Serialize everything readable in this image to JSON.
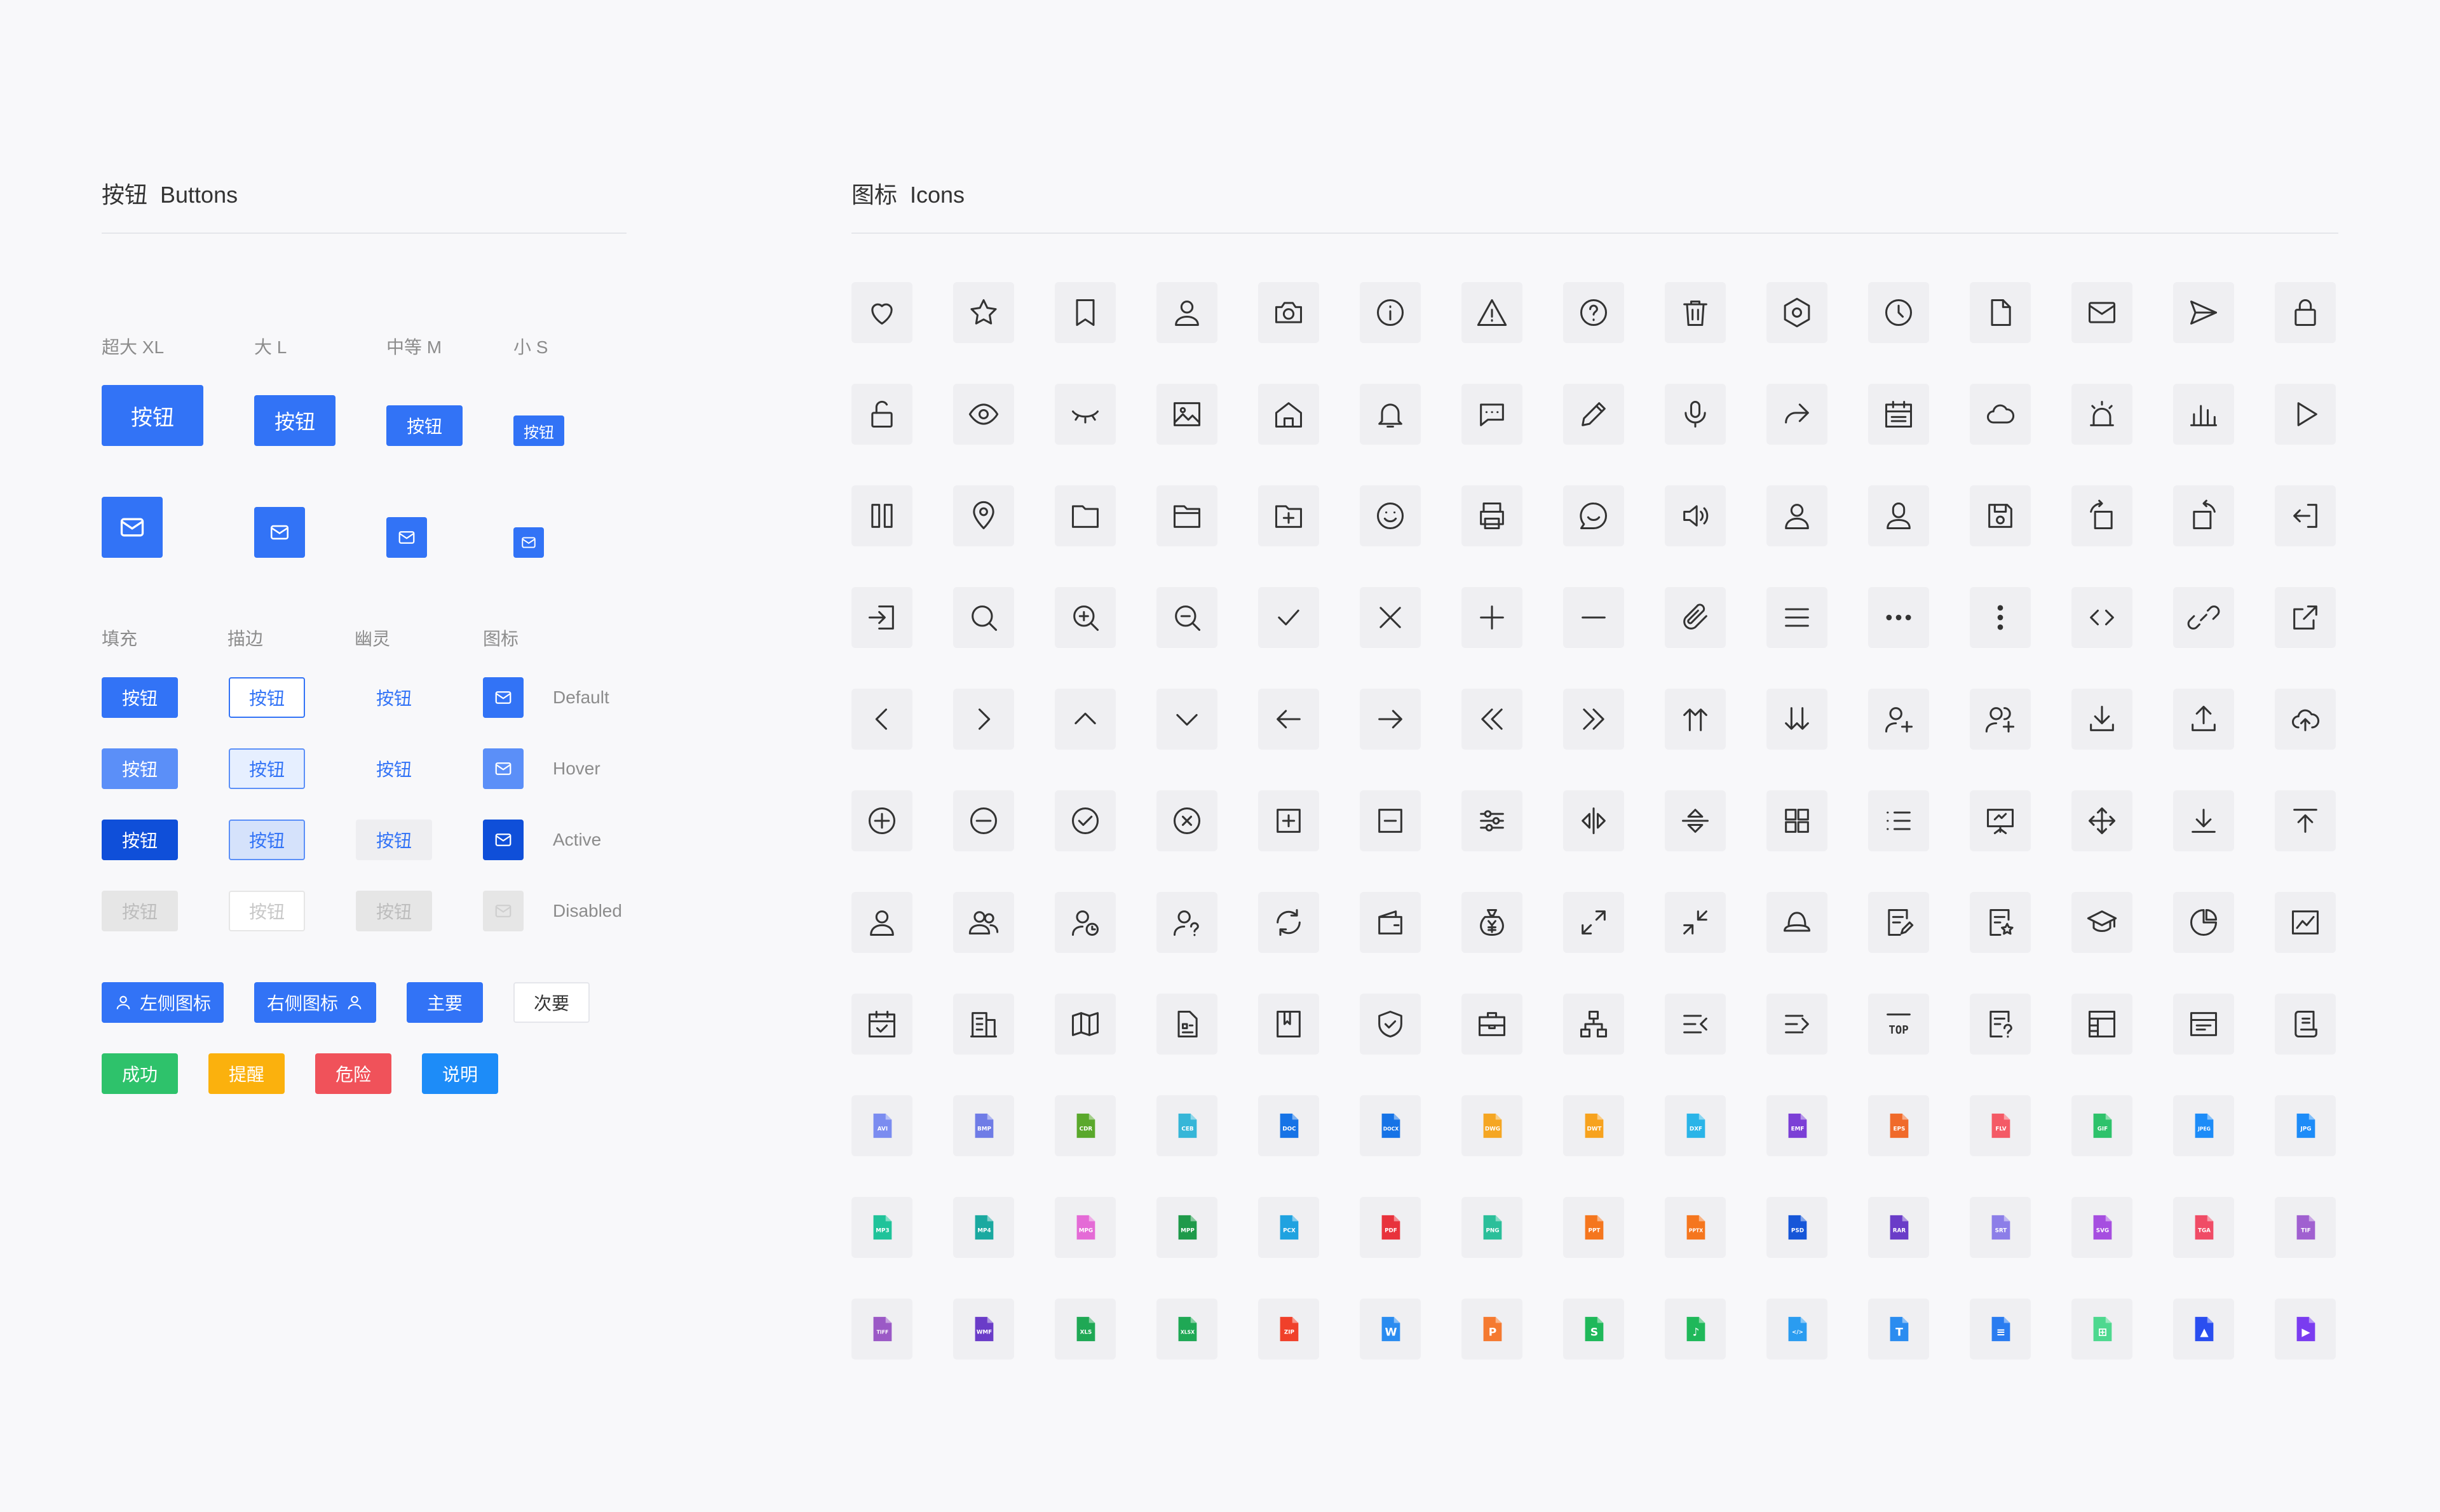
{
  "buttons_section": {
    "title": "按钮  Buttons",
    "sizes": [
      "超大 XL",
      "大 L",
      "中等 M",
      "小 S"
    ],
    "button_label": "按钮",
    "styles": [
      "填充",
      "描边",
      "幽灵",
      "图标"
    ],
    "states": [
      "Default",
      "Hover",
      "Active",
      "Disabled"
    ],
    "extra": {
      "left_icon": "左侧图标",
      "right_icon": "右侧图标",
      "primary": "主要",
      "secondary": "次要",
      "success": "成功",
      "warning": "提醒",
      "danger": "危险",
      "info": "说明"
    },
    "colors": {
      "primary": "#3273f6",
      "hover": "#5b8ff8",
      "active": "#0f4fd9",
      "disabled_bg": "#e6e6e6",
      "success": "#2ec26b",
      "warning": "#fbb10d",
      "danger": "#f0525a",
      "info": "#1d8cf8"
    }
  },
  "icons_section": {
    "title": "图标  Icons",
    "outline_icons": [
      "heart-icon",
      "star-icon",
      "bookmark-icon",
      "user-icon",
      "camera-icon",
      "info-icon",
      "warning-icon",
      "help-icon",
      "trash-icon",
      "settings-hex-icon",
      "clock-icon",
      "file-icon",
      "mail-icon",
      "send-icon",
      "lock-icon",
      "unlock-icon",
      "eye-icon",
      "eye-closed-icon",
      "image-icon",
      "home-icon",
      "bell-icon",
      "chat-icon",
      "pencil-icon",
      "microphone-icon",
      "share-icon",
      "calendar-icon",
      "cloud-icon",
      "alarm-light-icon",
      "bar-chart-icon",
      "play-icon",
      "pause-icon",
      "location-icon",
      "folder-icon",
      "folder-open-icon",
      "folder-add-icon",
      "smile-icon",
      "printer-icon",
      "message-smile-icon",
      "volume-icon",
      "user-outline-icon",
      "user-alt-icon",
      "save-icon",
      "rotate-left-icon",
      "rotate-right-icon",
      "logout-icon",
      "login-icon",
      "search-icon",
      "zoom-in-icon",
      "zoom-out-icon",
      "check-icon",
      "close-icon",
      "plus-icon",
      "minus-icon",
      "attachment-icon",
      "menu-icon",
      "more-horizontal-icon",
      "more-vertical-icon",
      "code-icon",
      "link-icon",
      "external-link-icon",
      "chevron-left-icon",
      "chevron-right-icon",
      "chevron-up-icon",
      "chevron-down-icon",
      "arrow-left-icon",
      "arrow-right-icon",
      "double-left-icon",
      "double-right-icon",
      "sort-up-icon",
      "sort-down-icon",
      "user-add-icon",
      "users-add-icon",
      "download-icon",
      "upload-icon",
      "cloud-upload-icon",
      "plus-circle-icon",
      "minus-circle-icon",
      "check-circle-icon",
      "close-circle-icon",
      "plus-square-icon",
      "minus-square-icon",
      "sliders-icon",
      "flip-horizontal-icon",
      "flip-vertical-icon",
      "grid-icon",
      "list-icon",
      "presentation-icon",
      "move-icon",
      "download-line-icon",
      "to-top-icon",
      "person-icon",
      "team-icon",
      "user-time-icon",
      "user-question-icon",
      "refresh-icon",
      "wallet-icon",
      "money-bag-icon",
      "expand-icon",
      "compress-icon",
      "hat-icon",
      "document-edit-icon",
      "document-star-icon",
      "graduation-icon",
      "pie-chart-icon",
      "line-chart-icon",
      "calendar-check-icon",
      "building-icon",
      "map-icon",
      "id-card-icon",
      "book-icon",
      "shield-icon",
      "briefcase-icon",
      "org-chart-icon",
      "indent-left-icon",
      "indent-right-icon",
      "top-icon",
      "document-question-icon",
      "layout-icon",
      "news-icon",
      "contract-icon"
    ],
    "file_icons": [
      {
        "label": "AVI",
        "color": "#7b8cf0"
      },
      {
        "label": "BMP",
        "color": "#6f7ce6"
      },
      {
        "label": "CDR",
        "color": "#5aa82c"
      },
      {
        "label": "CEB",
        "color": "#36b6d8"
      },
      {
        "label": "DOC",
        "color": "#1673e6"
      },
      {
        "label": "DOCX",
        "color": "#1673e6"
      },
      {
        "label": "DWG",
        "color": "#f5a623"
      },
      {
        "label": "DWT",
        "color": "#f7a21e"
      },
      {
        "label": "DXF",
        "color": "#2ab4e8"
      },
      {
        "label": "EMF",
        "color": "#7b3fd6"
      },
      {
        "label": "EPS",
        "color": "#f06a2a"
      },
      {
        "label": "FLV",
        "color": "#f45a66"
      },
      {
        "label": "GIF",
        "color": "#2ec26b"
      },
      {
        "label": "JPEG",
        "color": "#1d8cf8"
      },
      {
        "label": "JPG",
        "color": "#1d8cf8"
      },
      {
        "label": "MP3",
        "color": "#20c39a"
      },
      {
        "label": "MP4",
        "color": "#1aa9a0"
      },
      {
        "label": "MPG",
        "color": "#e46bd6"
      },
      {
        "label": "MPP",
        "color": "#1f9a4a"
      },
      {
        "label": "PCX",
        "color": "#1fa2e0"
      },
      {
        "label": "PDF",
        "color": "#e8323c"
      },
      {
        "label": "PNG",
        "color": "#2bbf9a"
      },
      {
        "label": "PPT",
        "color": "#f5761e"
      },
      {
        "label": "PPTX",
        "color": "#f5761e"
      },
      {
        "label": "PSD",
        "color": "#1656d8"
      },
      {
        "label": "RAR",
        "color": "#6a3cc8"
      },
      {
        "label": "SRT",
        "color": "#8c7ee8"
      },
      {
        "label": "SVG",
        "color": "#a64ee0"
      },
      {
        "label": "TGA",
        "color": "#f04c66"
      },
      {
        "label": "TIF",
        "color": "#a060d0"
      },
      {
        "label": "TIFF",
        "color": "#9b59c6"
      },
      {
        "label": "WMF",
        "color": "#6a3cc8"
      },
      {
        "label": "XLS",
        "color": "#1fa855"
      },
      {
        "label": "XLSX",
        "color": "#1fa855"
      },
      {
        "label": "ZIP",
        "color": "#f0402a"
      },
      {
        "label": "W",
        "color": "#2a8cf0"
      },
      {
        "label": "P",
        "color": "#f57a30"
      },
      {
        "label": "S",
        "color": "#1fb85a"
      },
      {
        "label": "♪",
        "color": "#1fb85a"
      },
      {
        "label": "</>",
        "color": "#2a9cf0"
      },
      {
        "label": "T",
        "color": "#2a8cf0"
      },
      {
        "label": "≡",
        "color": "#2a7cf0"
      },
      {
        "label": "⊞",
        "color": "#4ed88f"
      },
      {
        "label": "▲",
        "color": "#2a4ef0"
      },
      {
        "label": "▶",
        "color": "#7a3cf0"
      }
    ]
  }
}
